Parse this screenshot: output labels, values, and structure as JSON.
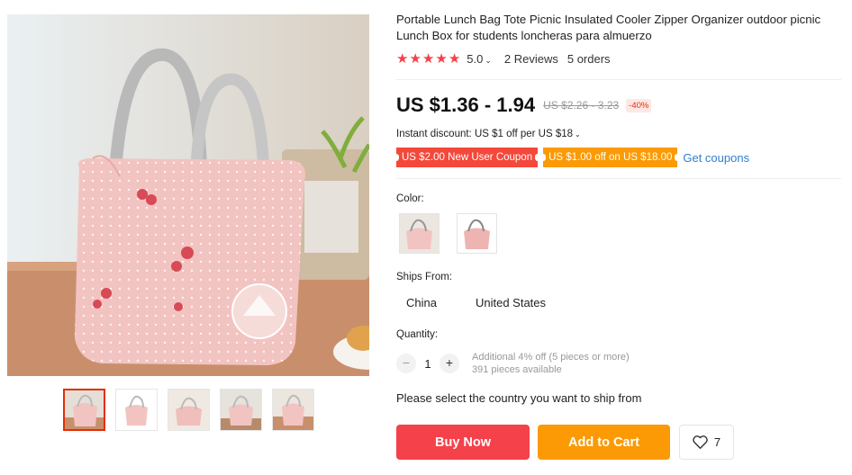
{
  "product": {
    "title": "Portable Lunch Bag Tote Picnic Insulated Cooler Zipper Organizer outdoor picnic Lunch Box for students loncheras para almuerzo",
    "rating": "5.0",
    "stars_filled": 5,
    "reviews": "2 Reviews",
    "orders": "5 orders",
    "price": "US $1.36 - 1.94",
    "original_price": "US $2.26 - 3.23",
    "discount": "-40%",
    "instant_discount": "Instant discount: US $1 off per US $18",
    "coupons": [
      {
        "label": "US $2.00 New User Coupon",
        "color": "#f4483b"
      },
      {
        "label": "US $1.00 off on US $18.00",
        "color": "#fb9a05"
      }
    ],
    "get_coupons": "Get coupons"
  },
  "gallery": {
    "main_image": "pink-cherry-lunch-bag-photo",
    "thumbnails": [
      "thumb-1",
      "thumb-2",
      "thumb-3",
      "thumb-4",
      "thumb-5"
    ],
    "active_thumb": 0
  },
  "options": {
    "color_label": "Color:",
    "colors": [
      "pink-bag-variant-1",
      "pink-bag-variant-2"
    ],
    "ships_from_label": "Ships From:",
    "ships_from": [
      "China",
      "United States"
    ],
    "quantity_label": "Quantity:",
    "quantity": "1",
    "qty_minus": "−",
    "qty_plus": "+",
    "additional_discount": "Additional 4% off (5 pieces or more)",
    "available": "391 pieces available",
    "select_country": "Please select the country you want to ship from"
  },
  "actions": {
    "buy_now": "Buy Now",
    "add_to_cart": "Add to Cart",
    "wishlist_count": "7"
  },
  "colors": {
    "accent_red": "#f5414a",
    "accent_orange": "#fb9a05",
    "link_blue": "#2e7fd1"
  }
}
